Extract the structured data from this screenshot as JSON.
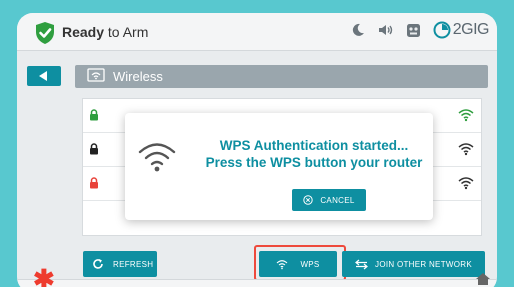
{
  "header": {
    "status_strong": "Ready",
    "status_rest": " to Arm",
    "brand": "2GIG",
    "icons": [
      "shield-check-icon",
      "moon-icon",
      "speaker-icon",
      "camera-icon",
      "brand-logo-icon"
    ]
  },
  "nav": {
    "back_icon": "back-arrow-icon",
    "title": "Wireless"
  },
  "networks": [
    {
      "lock_color": "#2f9e3f",
      "icon": "lock-icon",
      "signal_color": "#2f9e3f"
    },
    {
      "lock_color": "#222222",
      "icon": "lock-icon",
      "signal_color": "#333333"
    },
    {
      "lock_color": "#e8423a",
      "icon": "lock-icon",
      "signal_color": "#333333"
    }
  ],
  "dialog": {
    "line1": "WPS Authentication started...",
    "line2": "Press the WPS button your router",
    "cancel_label": "CANCEL"
  },
  "buttons": {
    "refresh": "REFRESH",
    "wps": "WPS",
    "join": "JOIN OTHER NETWORK"
  },
  "colors": {
    "accent": "#0e8fa1",
    "highlight": "#ee4a3c",
    "background": "#58c8cf"
  }
}
